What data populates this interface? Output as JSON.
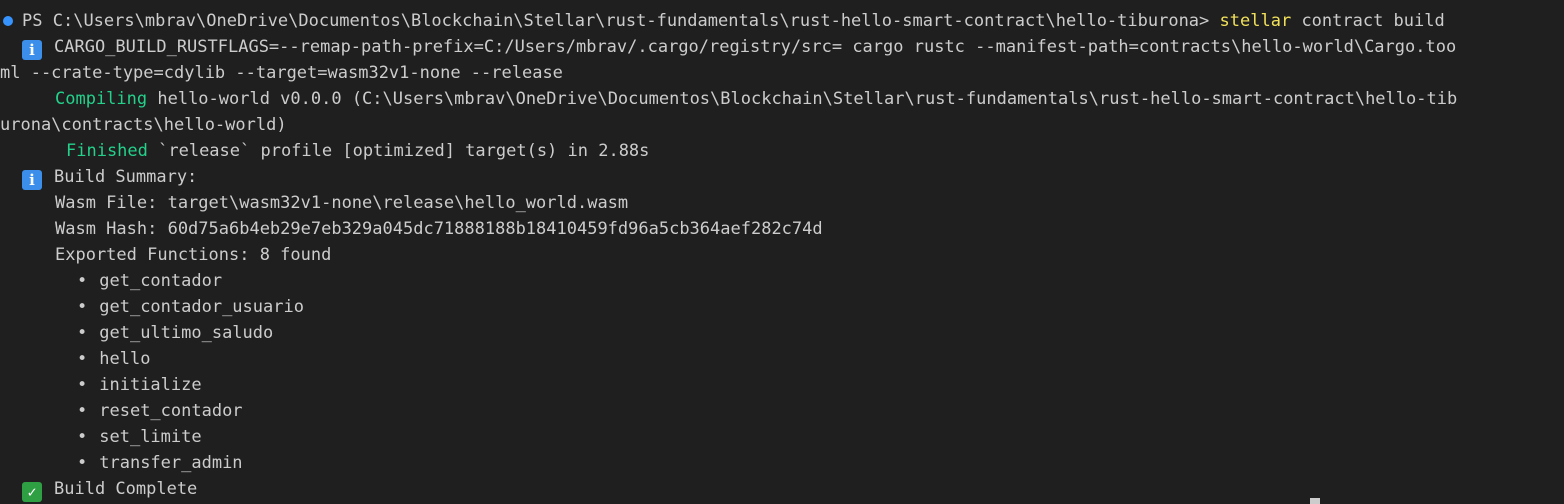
{
  "prompt": {
    "prefix": "PS",
    "path": "C:\\Users\\mbrav\\OneDrive\\Documentos\\Blockchain\\Stellar\\rust-fundamentals\\rust-hello-smart-contract\\hello-tiburona>",
    "command": "stellar",
    "args": "contract build"
  },
  "cargo_line": {
    "part1": "CARGO_BUILD_RUSTFLAGS=--remap-path-prefix=C:/Users/mbrav/.cargo/registry/src= cargo rustc --manifest-path=contracts\\hello-world\\Cargo.too",
    "part2": "ml --crate-type=cdylib --target=wasm32v1-none --release"
  },
  "compiling": {
    "label": "Compiling",
    "text1": " hello-world v0.0.0 (C:\\Users\\mbrav\\OneDrive\\Documentos\\Blockchain\\Stellar\\rust-fundamentals\\rust-hello-smart-contract\\hello-tib",
    "text2": "urona\\contracts\\hello-world)"
  },
  "finished": {
    "label": "Finished",
    "text": " `release` profile [optimized] target(s) in 2.88s"
  },
  "summary": {
    "title": "Build Summary:",
    "wasm_file": "Wasm File: target\\wasm32v1-none\\release\\hello_world.wasm",
    "wasm_hash": "Wasm Hash: 60d75a6b4eb29e7eb329a045dc71888188b18410459fd96a5cb364aef282c74d",
    "exported": "Exported Functions: 8 found",
    "functions": [
      "get_contador",
      "get_contador_usuario",
      "get_ultimo_saludo",
      "hello",
      "initialize",
      "reset_contador",
      "set_limite",
      "transfer_admin"
    ]
  },
  "complete": {
    "text": "Build Complete"
  },
  "icons": {
    "info": "info-icon",
    "check": "check-icon",
    "prompt_dot": "prompt-dot-icon"
  },
  "colors": {
    "background": "#1f1f1f",
    "foreground": "#cccccc",
    "command": "#f1e05a",
    "success": "#23d18b",
    "info": "#3b8eea",
    "dot": "#3794ff"
  }
}
